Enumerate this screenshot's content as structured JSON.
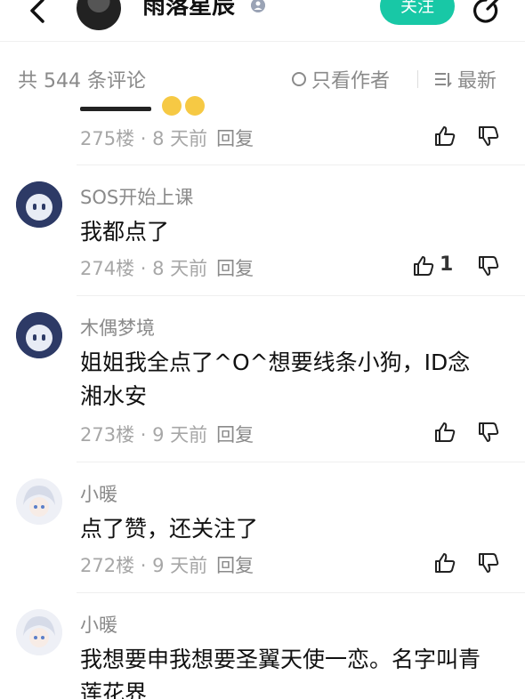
{
  "header": {
    "author_name": "雨落星辰",
    "follow_label": "关注",
    "icons": [
      "back-arrow-icon",
      "verified-badge-icon",
      "share-icon"
    ]
  },
  "filter": {
    "count_text": "共 544 条评论",
    "only_author_label": "只看作者",
    "sort_label": "最新"
  },
  "comments": [
    {
      "floor": "275楼",
      "time": "8 天前",
      "reply": "回复",
      "likes": ""
    },
    {
      "name": "SOS开始上课",
      "text": "我都点了",
      "floor": "274楼",
      "time": "8 天前",
      "reply": "回复",
      "likes": "1"
    },
    {
      "name": "木偶梦境",
      "text": "姐姐我全点了^O^想要线条小狗，ID念湘水安",
      "floor": "273楼",
      "time": "9 天前",
      "reply": "回复",
      "likes": ""
    },
    {
      "name": "小暖",
      "text": "点了赞，还关注了",
      "floor": "272楼",
      "time": "9 天前",
      "reply": "回复",
      "likes": ""
    },
    {
      "name": "小暖",
      "text": "我想要申我想要圣翼天使一恋。名字叫青莲花界"
    }
  ],
  "colors": {
    "accent": "#18c8a6",
    "muted": "#8a8a8a"
  }
}
